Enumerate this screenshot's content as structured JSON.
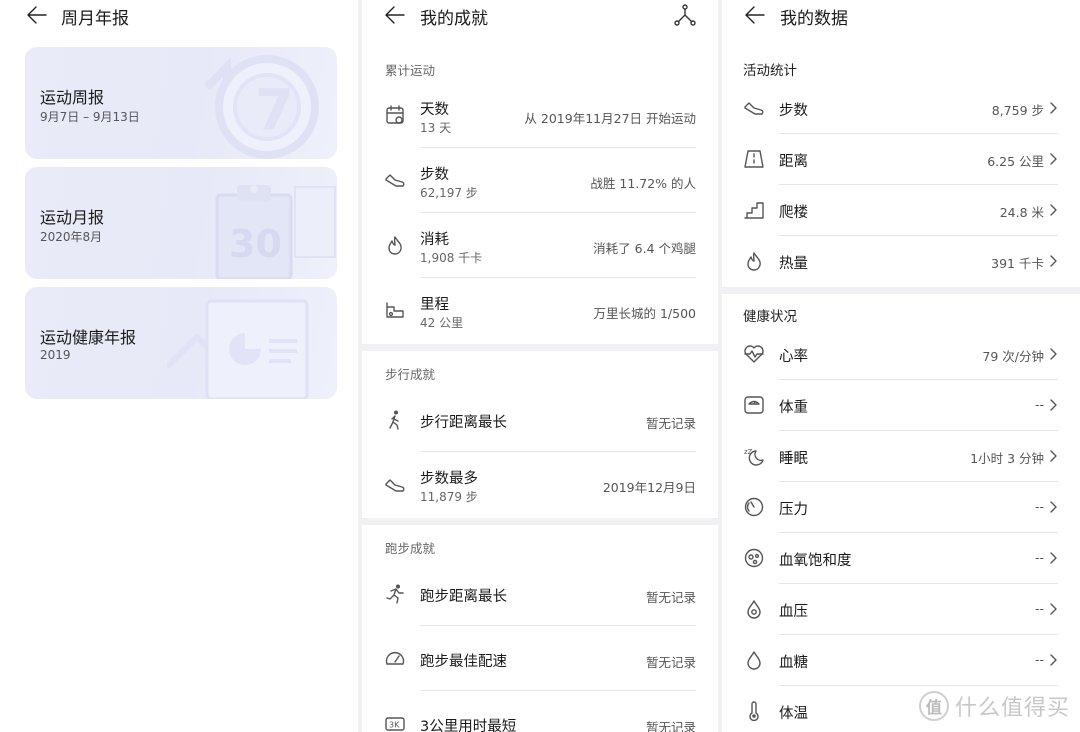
{
  "reports": {
    "title": "周月年报",
    "cards": [
      {
        "title": "运动周报",
        "sub": "9月7日 – 9月13日",
        "deco_text": "7"
      },
      {
        "title": "运动月报",
        "sub": "2020年8月",
        "deco_text": "30"
      },
      {
        "title": "运动健康年报",
        "sub": "2019"
      }
    ]
  },
  "achievements": {
    "title": "我的成就",
    "sections": [
      {
        "label": "累计运动"
      },
      {
        "label": "步行成就"
      },
      {
        "label": "跑步成就"
      }
    ],
    "cumulative": [
      {
        "name": "天数",
        "value": "13 天",
        "right": "从 2019年11月27日 开始运动",
        "icon": "calendar-icon"
      },
      {
        "name": "步数",
        "value": "62,197 步",
        "right": "战胜 11.72% 的人",
        "icon": "shoe-icon"
      },
      {
        "name": "消耗",
        "value": "1,908 千卡",
        "right": "消耗了 6.4 个鸡腿",
        "icon": "flame-icon"
      },
      {
        "name": "里程",
        "value": "42 公里",
        "right": "万里长城的 1/500",
        "icon": "path-icon"
      }
    ],
    "walking": [
      {
        "name": "步行距离最长",
        "right": "暂无记录",
        "icon": "walker-icon"
      },
      {
        "name": "步数最多",
        "value": "11,879 步",
        "right": "2019年12月9日",
        "icon": "shoe-icon"
      }
    ],
    "running": [
      {
        "name": "跑步距离最长",
        "right": "暂无记录",
        "icon": "runner-icon"
      },
      {
        "name": "跑步最佳配速",
        "right": "暂无记录",
        "icon": "speedometer-icon"
      },
      {
        "name": "3公里用时最短",
        "right": "暂无记录",
        "icon": "3k-icon",
        "icon_text": "3K"
      }
    ]
  },
  "mydata": {
    "title": "我的数据",
    "activity_label": "活动统计",
    "health_label": "健康状况",
    "activity": [
      {
        "name": "步数",
        "value": "8,759 步",
        "icon": "shoe-icon"
      },
      {
        "name": "距离",
        "value": "6.25 公里",
        "icon": "distance-icon"
      },
      {
        "name": "爬楼",
        "value": "24.8 米",
        "icon": "stairs-icon"
      },
      {
        "name": "热量",
        "value": "391 千卡",
        "icon": "flame-icon"
      }
    ],
    "health": [
      {
        "name": "心率",
        "value": "79 次/分钟",
        "icon": "heart-rate-icon"
      },
      {
        "name": "体重",
        "value": "-- ",
        "icon": "scale-icon"
      },
      {
        "name": "睡眠",
        "value": "1小时 3 分钟",
        "icon": "sleep-icon",
        "icon_text": "zZ"
      },
      {
        "name": "压力",
        "value": "--",
        "icon": "stress-gauge-icon"
      },
      {
        "name": "血氧饱和度",
        "value": "--",
        "icon": "blood-oxygen-icon"
      },
      {
        "name": "血压",
        "value": "--",
        "icon": "blood-pressure-icon"
      },
      {
        "name": "血糖",
        "value": "--",
        "icon": "blood-sugar-icon"
      },
      {
        "name": "体温",
        "value": "",
        "icon": "thermometer-icon"
      }
    ]
  },
  "watermark": {
    "logo": "值",
    "text": "什么值得买"
  }
}
